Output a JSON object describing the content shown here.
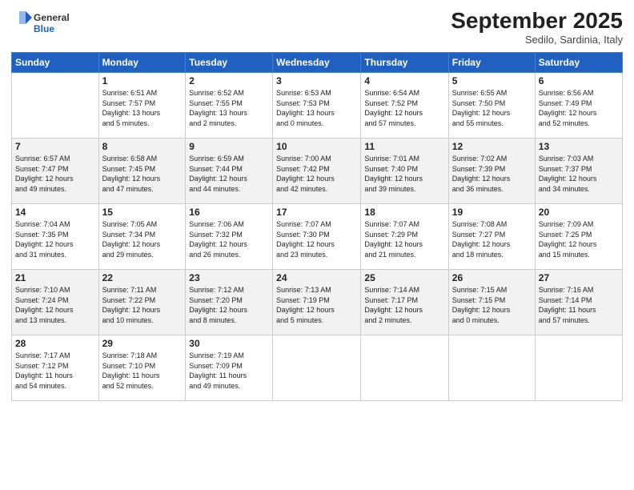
{
  "logo": {
    "general": "General",
    "blue": "Blue"
  },
  "header": {
    "month": "September 2025",
    "location": "Sedilo, Sardinia, Italy"
  },
  "weekdays": [
    "Sunday",
    "Monday",
    "Tuesday",
    "Wednesday",
    "Thursday",
    "Friday",
    "Saturday"
  ],
  "weeks": [
    [
      {
        "day": "",
        "info": ""
      },
      {
        "day": "1",
        "info": "Sunrise: 6:51 AM\nSunset: 7:57 PM\nDaylight: 13 hours\nand 5 minutes."
      },
      {
        "day": "2",
        "info": "Sunrise: 6:52 AM\nSunset: 7:55 PM\nDaylight: 13 hours\nand 2 minutes."
      },
      {
        "day": "3",
        "info": "Sunrise: 6:53 AM\nSunset: 7:53 PM\nDaylight: 13 hours\nand 0 minutes."
      },
      {
        "day": "4",
        "info": "Sunrise: 6:54 AM\nSunset: 7:52 PM\nDaylight: 12 hours\nand 57 minutes."
      },
      {
        "day": "5",
        "info": "Sunrise: 6:55 AM\nSunset: 7:50 PM\nDaylight: 12 hours\nand 55 minutes."
      },
      {
        "day": "6",
        "info": "Sunrise: 6:56 AM\nSunset: 7:49 PM\nDaylight: 12 hours\nand 52 minutes."
      }
    ],
    [
      {
        "day": "7",
        "info": "Sunrise: 6:57 AM\nSunset: 7:47 PM\nDaylight: 12 hours\nand 49 minutes."
      },
      {
        "day": "8",
        "info": "Sunrise: 6:58 AM\nSunset: 7:45 PM\nDaylight: 12 hours\nand 47 minutes."
      },
      {
        "day": "9",
        "info": "Sunrise: 6:59 AM\nSunset: 7:44 PM\nDaylight: 12 hours\nand 44 minutes."
      },
      {
        "day": "10",
        "info": "Sunrise: 7:00 AM\nSunset: 7:42 PM\nDaylight: 12 hours\nand 42 minutes."
      },
      {
        "day": "11",
        "info": "Sunrise: 7:01 AM\nSunset: 7:40 PM\nDaylight: 12 hours\nand 39 minutes."
      },
      {
        "day": "12",
        "info": "Sunrise: 7:02 AM\nSunset: 7:39 PM\nDaylight: 12 hours\nand 36 minutes."
      },
      {
        "day": "13",
        "info": "Sunrise: 7:03 AM\nSunset: 7:37 PM\nDaylight: 12 hours\nand 34 minutes."
      }
    ],
    [
      {
        "day": "14",
        "info": "Sunrise: 7:04 AM\nSunset: 7:35 PM\nDaylight: 12 hours\nand 31 minutes."
      },
      {
        "day": "15",
        "info": "Sunrise: 7:05 AM\nSunset: 7:34 PM\nDaylight: 12 hours\nand 29 minutes."
      },
      {
        "day": "16",
        "info": "Sunrise: 7:06 AM\nSunset: 7:32 PM\nDaylight: 12 hours\nand 26 minutes."
      },
      {
        "day": "17",
        "info": "Sunrise: 7:07 AM\nSunset: 7:30 PM\nDaylight: 12 hours\nand 23 minutes."
      },
      {
        "day": "18",
        "info": "Sunrise: 7:07 AM\nSunset: 7:29 PM\nDaylight: 12 hours\nand 21 minutes."
      },
      {
        "day": "19",
        "info": "Sunrise: 7:08 AM\nSunset: 7:27 PM\nDaylight: 12 hours\nand 18 minutes."
      },
      {
        "day": "20",
        "info": "Sunrise: 7:09 AM\nSunset: 7:25 PM\nDaylight: 12 hours\nand 15 minutes."
      }
    ],
    [
      {
        "day": "21",
        "info": "Sunrise: 7:10 AM\nSunset: 7:24 PM\nDaylight: 12 hours\nand 13 minutes."
      },
      {
        "day": "22",
        "info": "Sunrise: 7:11 AM\nSunset: 7:22 PM\nDaylight: 12 hours\nand 10 minutes."
      },
      {
        "day": "23",
        "info": "Sunrise: 7:12 AM\nSunset: 7:20 PM\nDaylight: 12 hours\nand 8 minutes."
      },
      {
        "day": "24",
        "info": "Sunrise: 7:13 AM\nSunset: 7:19 PM\nDaylight: 12 hours\nand 5 minutes."
      },
      {
        "day": "25",
        "info": "Sunrise: 7:14 AM\nSunset: 7:17 PM\nDaylight: 12 hours\nand 2 minutes."
      },
      {
        "day": "26",
        "info": "Sunrise: 7:15 AM\nSunset: 7:15 PM\nDaylight: 12 hours\nand 0 minutes."
      },
      {
        "day": "27",
        "info": "Sunrise: 7:16 AM\nSunset: 7:14 PM\nDaylight: 11 hours\nand 57 minutes."
      }
    ],
    [
      {
        "day": "28",
        "info": "Sunrise: 7:17 AM\nSunset: 7:12 PM\nDaylight: 11 hours\nand 54 minutes."
      },
      {
        "day": "29",
        "info": "Sunrise: 7:18 AM\nSunset: 7:10 PM\nDaylight: 11 hours\nand 52 minutes."
      },
      {
        "day": "30",
        "info": "Sunrise: 7:19 AM\nSunset: 7:09 PM\nDaylight: 11 hours\nand 49 minutes."
      },
      {
        "day": "",
        "info": ""
      },
      {
        "day": "",
        "info": ""
      },
      {
        "day": "",
        "info": ""
      },
      {
        "day": "",
        "info": ""
      }
    ]
  ]
}
